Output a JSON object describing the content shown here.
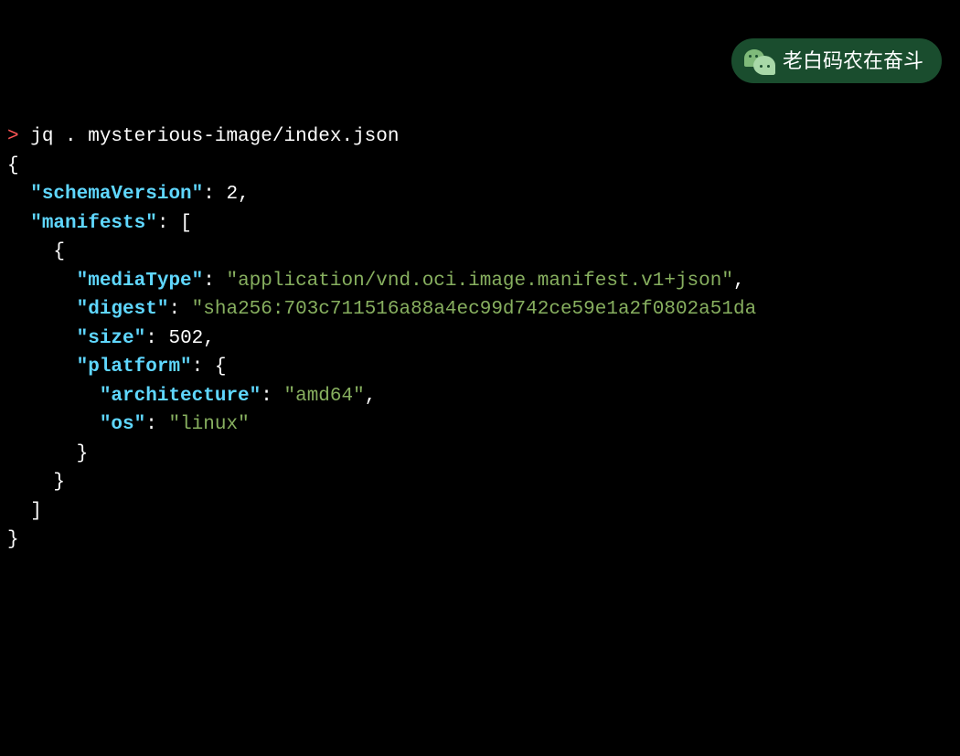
{
  "terminal": {
    "prompt": ">",
    "command": "jq . mysterious-image/index.json"
  },
  "json_output": {
    "keys": {
      "schemaVersion": "\"schemaVersion\"",
      "manifests": "\"manifests\"",
      "mediaType": "\"mediaType\"",
      "digest": "\"digest\"",
      "size": "\"size\"",
      "platform": "\"platform\"",
      "architecture": "\"architecture\"",
      "os": "\"os\""
    },
    "values": {
      "schemaVersion": "2",
      "mediaType": "\"application/vnd.oci.image.manifest.v1+json\"",
      "digest": "\"sha256:703c711516a88a4ec99d742ce59e1a2f0802a51da",
      "size": "502",
      "architecture": "\"amd64\"",
      "os": "\"linux\""
    },
    "punct": {
      "open_brace": "{",
      "close_brace": "}",
      "open_bracket": "[",
      "close_bracket": "]",
      "colon": ":",
      "comma": ","
    }
  },
  "watermark": {
    "text": "老白码农在奋斗"
  }
}
